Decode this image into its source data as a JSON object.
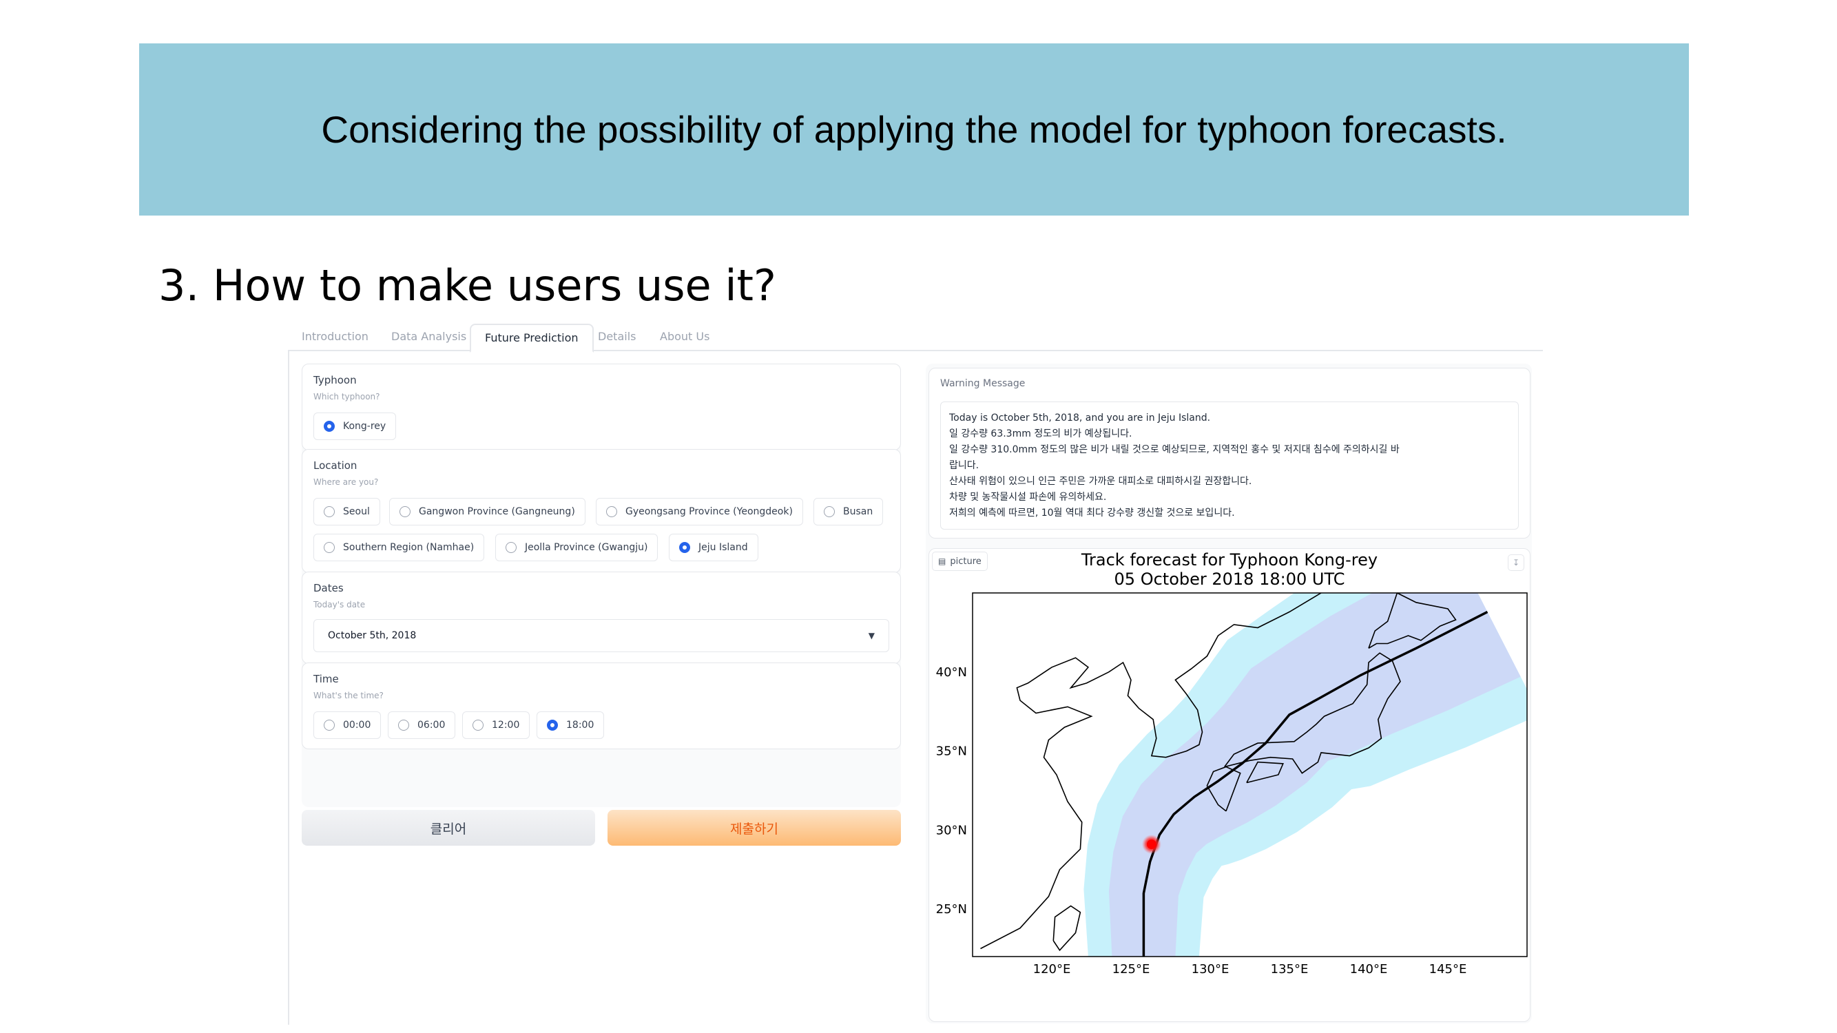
{
  "slide": {
    "banner": "Considering the possibility of applying the model for typhoon forecasts.",
    "heading": "3. How to make users use it?"
  },
  "tabs": [
    "Introduction",
    "Data Analysis",
    "Future Prediction",
    "Details",
    "About Us"
  ],
  "active_tab": "Future Prediction",
  "form": {
    "typhoon": {
      "label": "Typhoon",
      "sublabel": "Which typhoon?",
      "options": [
        "Kong-rey"
      ],
      "selected": "Kong-rey"
    },
    "location": {
      "label": "Location",
      "sublabel": "Where are you?",
      "options": [
        "Seoul",
        "Gangwon Province (Gangneung)",
        "Gyeongsang Province (Yeongdeok)",
        "Busan",
        "Southern Region (Namhae)",
        "Jeolla Province (Gwangju)",
        "Jeju Island"
      ],
      "selected": "Jeju Island"
    },
    "dates": {
      "label": "Dates",
      "sublabel": "Today's date",
      "value": "October 5th, 2018"
    },
    "time": {
      "label": "Time",
      "sublabel": "What's the time?",
      "options": [
        "00:00",
        "06:00",
        "12:00",
        "18:00"
      ],
      "selected": "18:00"
    },
    "clear_label": "클리어",
    "submit_label": "제출하기"
  },
  "warning": {
    "title": "Warning Message",
    "lines": [
      "Today is October 5th, 2018, and you are in Jeju Island.",
      "일 강수량 63.3mm 정도의 비가 예상됩니다.",
      "일 강수량 310.0mm 정도의 많은 비가 내릴 것으로 예상되므로, 지역적인 홍수 및 저지대 침수에 주의하시길 바",
      "랍니다.",
      "산사태 위험이 있으니 인근 주민은 가까운 대피소로 대피하시길 권장합니다.",
      "차량 및 농작물시설 파손에 유의하세요.",
      "저희의 예측에 따르면, 10월 역대 최다 강수량 갱신할 것으로 보입니다."
    ]
  },
  "image": {
    "tag": "picture",
    "tag_icon": "image-icon",
    "download_icon": "download-icon"
  },
  "chart_data": {
    "type": "map",
    "title": "Track forecast for Typhoon Kong-rey",
    "subtitle": "05 October 2018 18:00 UTC",
    "xlim": [
      115,
      150
    ],
    "ylim": [
      22,
      45
    ],
    "xticks": [
      120,
      125,
      130,
      135,
      140,
      145
    ],
    "yticks": [
      25,
      30,
      35,
      40
    ],
    "xtick_labels": [
      "120°E",
      "125°E",
      "130°E",
      "135°E",
      "140°E",
      "145°E"
    ],
    "ytick_labels": [
      "25°N",
      "30°N",
      "35°N",
      "40°N"
    ],
    "track": [
      [
        125.8,
        22
      ],
      [
        125.8,
        26
      ],
      [
        126.2,
        28.0
      ],
      [
        126.8,
        29.7
      ],
      [
        127.7,
        31
      ],
      [
        129.0,
        32.1
      ],
      [
        130.5,
        33.1
      ],
      [
        132.0,
        34.2
      ],
      [
        133.5,
        35.5
      ],
      [
        135.0,
        37.3
      ],
      [
        137.0,
        38.4
      ],
      [
        139.5,
        39.8
      ],
      [
        143.0,
        41.5
      ],
      [
        147.5,
        43.8
      ]
    ],
    "current_position": [
      126.3,
      29.1
    ],
    "current_position_color": "#ff0000",
    "inner_cone_color": "#cdd9f7",
    "outer_cone_color": "#c7f1fb"
  }
}
